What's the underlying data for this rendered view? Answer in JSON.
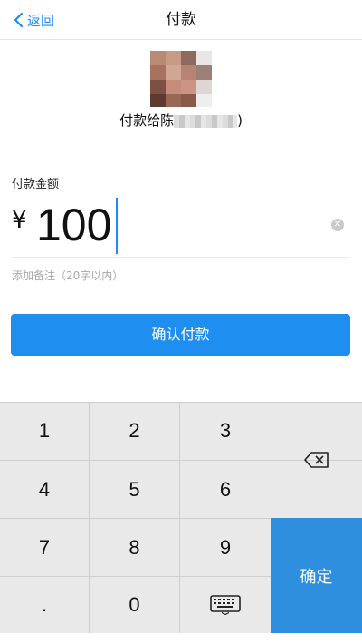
{
  "nav": {
    "back_label": "返回",
    "title": "付款"
  },
  "payee": {
    "prefix": "付款给陈",
    "suffix": ")"
  },
  "amount": {
    "label": "付款金额",
    "currency": "¥",
    "value": "100"
  },
  "note_placeholder": "添加备注（20字以内）",
  "confirm_pay_label": "确认付款",
  "keypad": {
    "keys": [
      "1",
      "2",
      "3",
      "4",
      "5",
      "6",
      "7",
      "8",
      "9",
      ".",
      "0"
    ],
    "confirm_label": "确定",
    "icons": {
      "backspace": "backspace-icon",
      "keyboard": "keyboard-icon",
      "back": "chevron-left-icon",
      "clear": "clear-icon"
    }
  },
  "colors": {
    "accent": "#1a8cff",
    "button": "#1e8ff0",
    "confirm_key": "#2d8fde",
    "keypad_bg": "#e9e9ea"
  }
}
